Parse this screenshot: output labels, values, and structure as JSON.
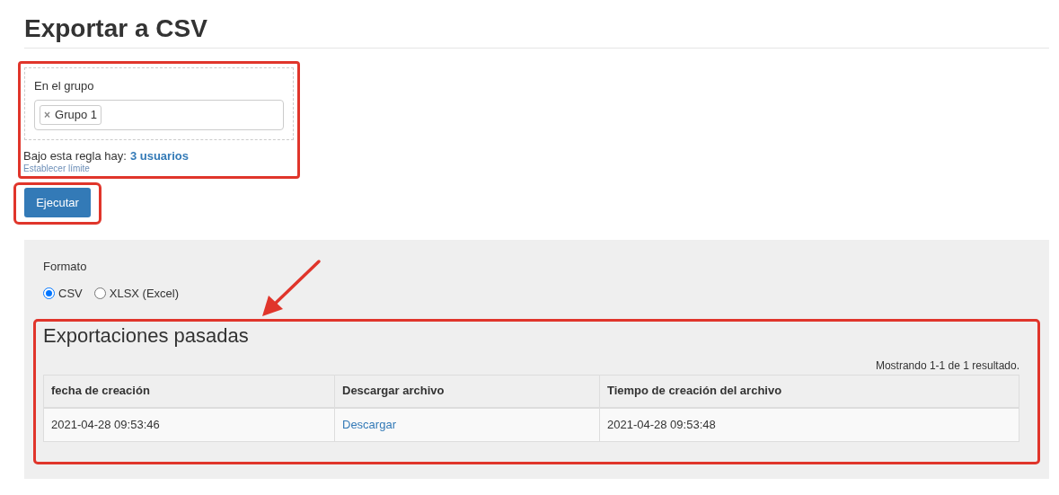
{
  "title": "Exportar a CSV",
  "filter": {
    "label": "En el grupo",
    "tags": [
      {
        "label": "Grupo 1",
        "remove": "×"
      }
    ]
  },
  "rule": {
    "prefix": "Bajo esta regla hay:",
    "count_link": "3 usuarios",
    "limit_link": "Establecer límite"
  },
  "run_button": "Ejecutar",
  "format": {
    "label": "Formato",
    "options": [
      {
        "label": "CSV",
        "selected": true
      },
      {
        "label": "XLSX (Excel)",
        "selected": false
      }
    ]
  },
  "past_exports": {
    "title": "Exportaciones pasadas",
    "summary": "Mostrando 1-1 de 1 resultado.",
    "columns": [
      "fecha de creación",
      "Descargar archivo",
      "Tiempo de creación del archivo"
    ],
    "rows": [
      [
        {
          "kind": "text",
          "text": "2021-04-28 09:53:46"
        },
        {
          "kind": "link",
          "text": "Descargar"
        },
        {
          "kind": "text",
          "text": "2021-04-28 09:53:48"
        }
      ]
    ]
  }
}
